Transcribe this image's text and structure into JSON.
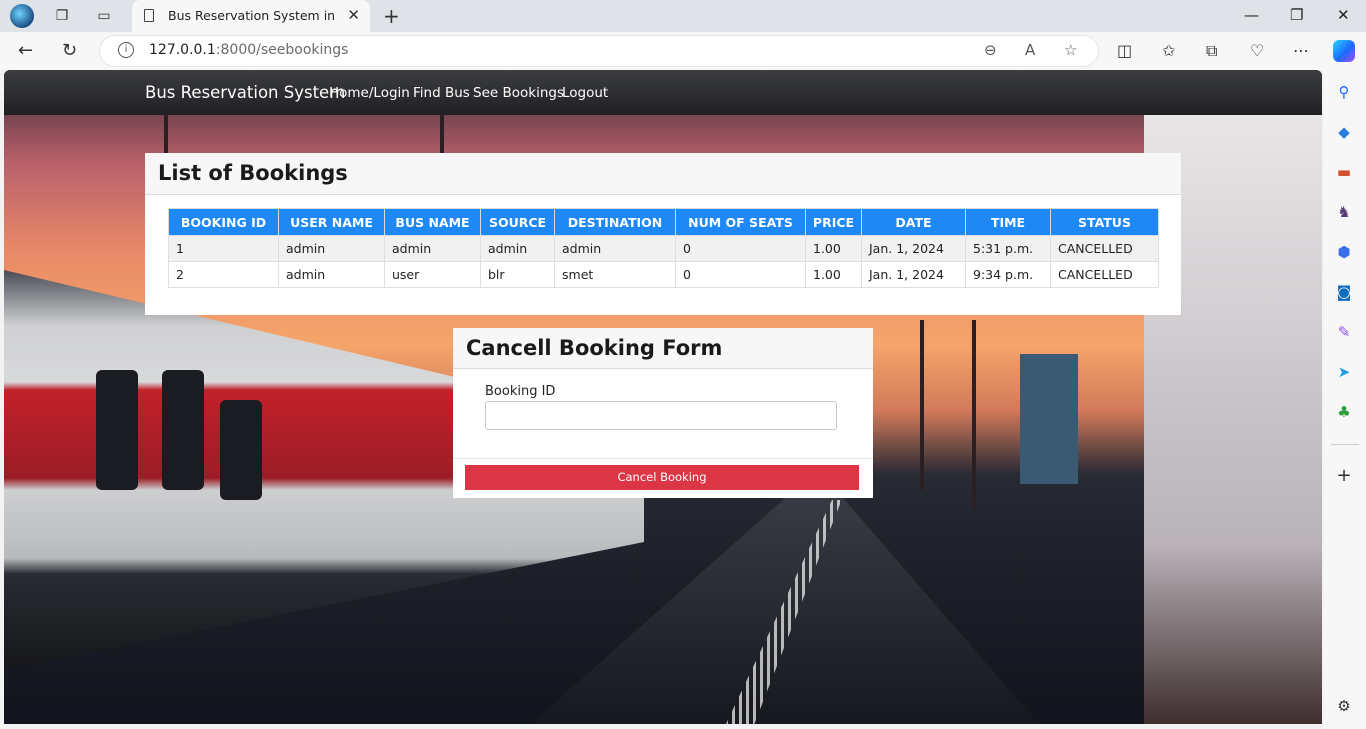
{
  "browser": {
    "tab_title": "Bus Reservation System in Django",
    "url_host": "127.0.0.1",
    "url_rest": ":8000/seebookings"
  },
  "navbar": {
    "brand": "Bus Reservation System",
    "links": [
      "Home/Login",
      "Find Bus",
      "See Bookings",
      "Logout"
    ]
  },
  "bookings": {
    "title": "List of Bookings",
    "headers": [
      "BOOKING ID",
      "USER NAME",
      "BUS NAME",
      "SOURCE",
      "DESTINATION",
      "NUM OF SEATS",
      "PRICE",
      "DATE",
      "TIME",
      "STATUS"
    ],
    "rows": [
      [
        "1",
        "admin",
        "admin",
        "admin",
        "admin",
        "0",
        "1.00",
        "Jan. 1, 2024",
        "5:31 p.m.",
        "CANCELLED"
      ],
      [
        "2",
        "admin",
        "user",
        "blr",
        "smet",
        "0",
        "1.00",
        "Jan. 1, 2024",
        "9:34 p.m.",
        "CANCELLED"
      ]
    ]
  },
  "cancel_form": {
    "title": "Cancell Booking Form",
    "label": "Booking ID",
    "input_value": "",
    "button": "Cancel Booking"
  },
  "colors": {
    "table_header": "#1e88f5",
    "cancel_button": "#dc3545",
    "navbar": "#2b2c2e"
  }
}
